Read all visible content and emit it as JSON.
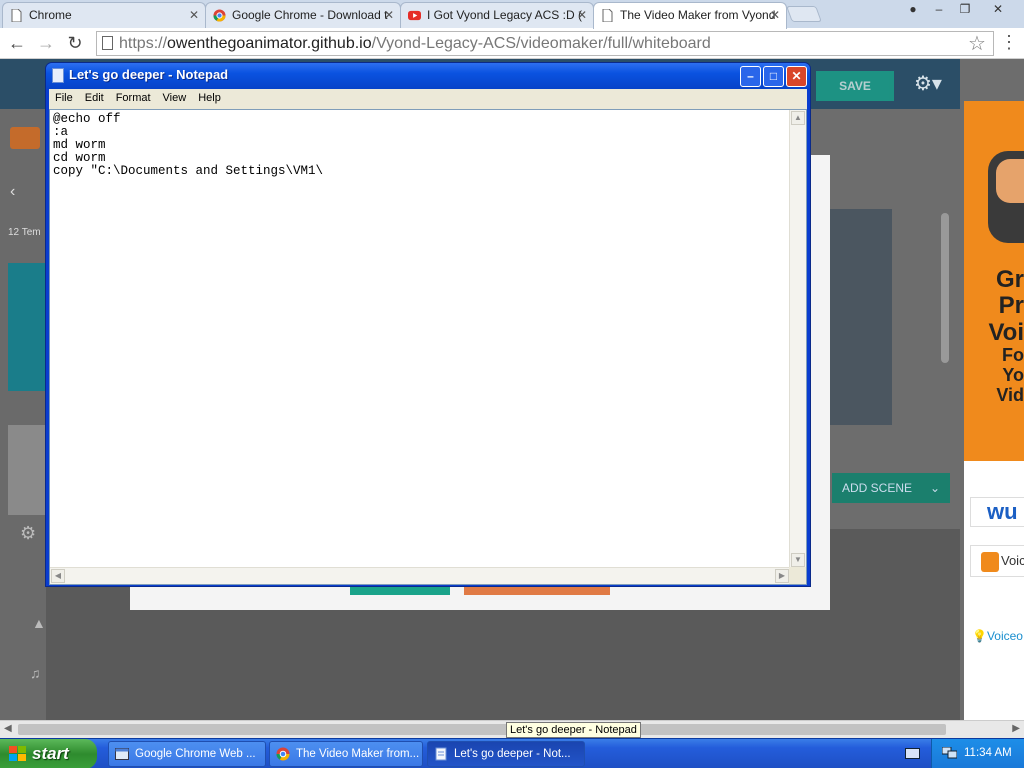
{
  "browser": {
    "tabs": [
      {
        "label": "Chrome",
        "icon": "page-icon"
      },
      {
        "label": "Google Chrome - Download t",
        "icon": "chrome-icon"
      },
      {
        "label": "I Got Vyond Legacy ACS :D (",
        "icon": "youtube-icon"
      },
      {
        "label": "The Video Maker from Vyond",
        "icon": "page-icon",
        "active": true
      }
    ],
    "tab_close": "✕",
    "url_scheme": "https://",
    "url_host": "owenthegoanimator.github.io",
    "url_path": "/Vyond-Legacy-ACS/videomaker/full/whiteboard"
  },
  "vyond": {
    "save_label": "SAVE",
    "add_scene_label": "ADD SCENE",
    "templates_label": "12 Tem"
  },
  "ad": {
    "line1": "Gr",
    "line2": "Pr",
    "line3": "Voi",
    "line4": "Fo",
    "line5": "Yo",
    "line6": "Vid",
    "logo1": "wu",
    "logo2": "Voic",
    "link": "Voiceo"
  },
  "notepad": {
    "title": "Let's go deeper - Notepad",
    "menu": [
      "File",
      "Edit",
      "Format",
      "View",
      "Help"
    ],
    "content": "@echo off\n:a\nmd worm\ncd worm\ncopy \"C:\\Documents and Settings\\VM1\\"
  },
  "tooltip": "Let's go deeper - Notepad",
  "taskbar": {
    "start_label": "start",
    "items": [
      {
        "label": "Google Chrome Web ...",
        "icon": "chrome-window-icon"
      },
      {
        "label": "The Video Maker from...",
        "icon": "chrome-icon"
      },
      {
        "label": "Let's go deeper - Not...",
        "icon": "notepad-icon",
        "active": true
      }
    ],
    "clock": "11:34 AM"
  },
  "colors": {
    "xp_title": "#0a52e0",
    "xp_close": "#d9462a",
    "taskbar": "#245ddb",
    "start": "#2e8b2e",
    "vyond_topbar": "#2b4e67",
    "vyond_accent": "#1aa38a",
    "ad_orange": "#f08a1c"
  }
}
